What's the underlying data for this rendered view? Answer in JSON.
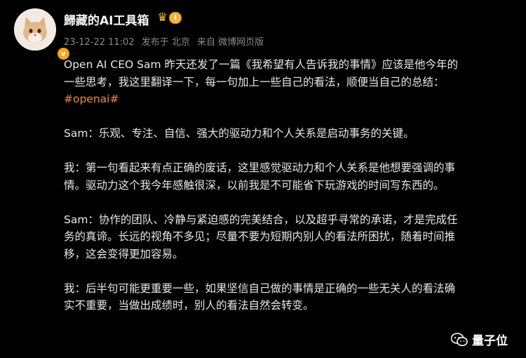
{
  "user": {
    "name": "歸藏的AI工具箱",
    "level": "I",
    "verified_mark": "v"
  },
  "meta": {
    "timestamp": "23-12-22 11:02",
    "location": "发布于 北京",
    "source": "来自 微博网页版"
  },
  "post": {
    "intro_line1": "Open AI CEO Sam 昨天还发了一篇《我希望有人告诉我的事情》应该是他今年的",
    "intro_line2": "一些思考，我这里翻译一下，每一句加上一些自己的看法，顺便当自己的总结：",
    "hashtag": "#openai#",
    "sam1": "Sam：乐观、专注、自信、强大的驱动力和个人关系是启动事务的关键。",
    "me1_line1": "我：第一句看起来有点正确的废话，这里感觉驱动力和个人关系是他想要强调的事",
    "me1_line2": "情。驱动力这个我今年感触很深，以前我是不可能省下玩游戏的时间写东西的。",
    "sam2_line1": "Sam：协作的团队、冷静与紧迫感的完美结合，以及超乎寻常的承诺，才是完成任",
    "sam2_line2": "务的真谛。长远的视角不多见；尽量不要为短期内别人的看法所困扰，随着时间推",
    "sam2_line3": "移，这会变得更加容易。",
    "me2_line1": "我：后半句可能更重要一些，如果坚信自己做的事情是正确的一些无关人的看法确",
    "me2_line2": "实不重要，当做出成绩时，别人的看法自然会转变。"
  },
  "watermark": {
    "label": "量子位",
    "icon": "wechat-icon"
  },
  "colors": {
    "background": "#000000",
    "hashtag": "#ee8a37",
    "badge": "#f2b43a",
    "verified": "#f7a51c"
  }
}
